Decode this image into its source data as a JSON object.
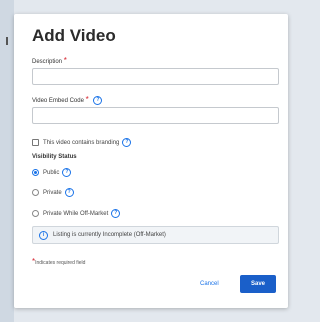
{
  "modal": {
    "title": "Add Video",
    "description_label": "Description",
    "description_value": "",
    "embed_label": "Video Embed Code",
    "embed_value": "",
    "branding_label": "This video contains branding",
    "visibility_label": "Visibility Status",
    "visibility_options": [
      {
        "label": "Public",
        "checked": true
      },
      {
        "label": "Private",
        "checked": false
      },
      {
        "label": "Private While Off-Market",
        "checked": false
      }
    ],
    "notice_text": "Listing is currently Incomplete (Off-Market)",
    "required_symbol": "*",
    "required_note": "Indicates required field",
    "cancel_label": "Cancel",
    "save_label": "Save"
  },
  "icons": {
    "help": "question-mark",
    "info": "info"
  },
  "colors": {
    "accent": "#1a5fc9",
    "required": "#d6232e"
  }
}
